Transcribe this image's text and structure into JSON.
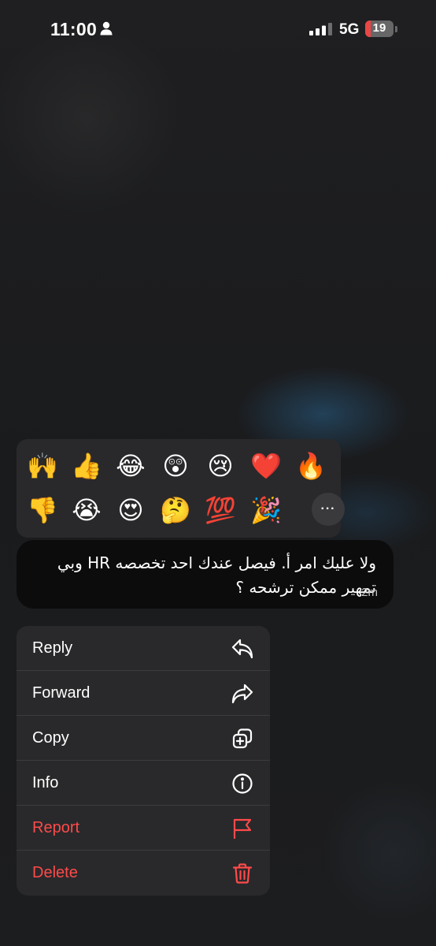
{
  "status_bar": {
    "time": "11:00",
    "network": "5G",
    "battery_level": "19",
    "battery_fraction": 0.19,
    "battery_color": "#eb4545"
  },
  "reactions": {
    "row1": [
      "🙌",
      "👍",
      "😂",
      "😲",
      "😢",
      "❤️",
      "🔥"
    ],
    "row2": [
      "👎",
      "😭",
      "😍",
      "🤔",
      "💯",
      "🎉"
    ],
    "more_label": "···"
  },
  "message": {
    "text": "ولا عليك امر أ. فيصل عندك احد تخصصه HR وبي تمهير ممكن ترشحه ؟",
    "time": "2m"
  },
  "context_menu": {
    "items": [
      {
        "label": "Reply",
        "icon": "reply-icon",
        "destructive": false
      },
      {
        "label": "Forward",
        "icon": "forward-icon",
        "destructive": false
      },
      {
        "label": "Copy",
        "icon": "copy-icon",
        "destructive": false
      },
      {
        "label": "Info",
        "icon": "info-icon",
        "destructive": false
      },
      {
        "label": "Report",
        "icon": "flag-icon",
        "destructive": true
      },
      {
        "label": "Delete",
        "icon": "trash-icon",
        "destructive": true
      }
    ]
  },
  "colors": {
    "destructive": "#ff4a4a",
    "menu_background": "#29292b",
    "bubble_background": "#0c0c0d"
  }
}
